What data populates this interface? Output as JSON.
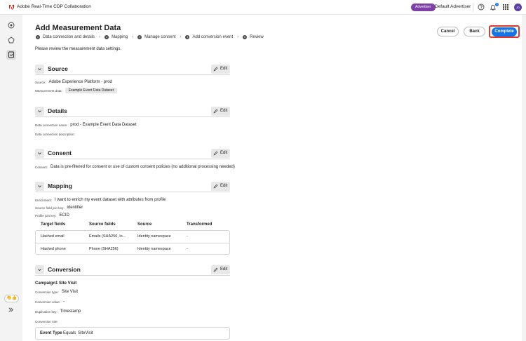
{
  "app": {
    "title": "Adobe Real-Time CDP Collaboration"
  },
  "topbar": {
    "advertiser_badge": "Advertiser",
    "advertiser_name": "Default Advertiser",
    "notification_count": "1",
    "avatar_initials": "JD"
  },
  "rail": {
    "emoji": "👏👍"
  },
  "page": {
    "title": "Add Measurement Data",
    "intro": "Please review the measurement data settings.",
    "steps": [
      {
        "num": "1",
        "label": "Data connection and details"
      },
      {
        "num": "2",
        "label": "Mapping"
      },
      {
        "num": "3",
        "label": "Manage consent"
      },
      {
        "num": "4",
        "label": "Add conversion event"
      },
      {
        "num": "5",
        "label": "Review"
      }
    ],
    "buttons": {
      "cancel": "Cancel",
      "back": "Back",
      "complete": "Complete"
    }
  },
  "edit_label": "Edit",
  "source": {
    "title": "Source",
    "source_key": "Source:",
    "source_value": "Adobe Experience Platform - prod",
    "measurement_key": "Measurement data:",
    "measurement_value": "Example Event Data Dataset"
  },
  "details": {
    "title": "Details",
    "name_key": "Data connection name:",
    "name_value": "prod - Example Event Data Dataset",
    "desc_key": "Data connection description:"
  },
  "consent": {
    "title": "Consent",
    "key": "Consent:",
    "value": "Data is pre-filtered for consent or use of custom consent policies (no additional processing needed)"
  },
  "mapping": {
    "title": "Mapping",
    "enrich_key": "Enrichment:",
    "enrich_value": "I want to enrich my event dataset with attributes from profile",
    "source_join_key": "Source field join key:",
    "source_join_value": "identifier",
    "profile_join_key": "Profile join key:",
    "profile_join_value": "ECID",
    "columns": [
      "Target fields",
      "Source fields",
      "Source",
      "Transformed"
    ],
    "rows": [
      [
        "Hashed email",
        "Emails (SHA256, lo...",
        "Identity namespace",
        "-"
      ],
      [
        "Hashed phone",
        "Phone (SHA256)",
        "Identity namespace",
        "-"
      ]
    ]
  },
  "conversion": {
    "title": "Conversion",
    "campaign_title": "Campaign1 Site Visit",
    "type_key": "Conversion type:",
    "type_value": "Site Visit",
    "value_key": "Conversion value:",
    "value_value": "-",
    "dup_key": "Duplication key:",
    "dup_value": "Timestamp",
    "rule_key": "Conversion rule:",
    "rule": {
      "field": "Event Type",
      "operator": "Equals",
      "value": "SiteVisit"
    }
  }
}
